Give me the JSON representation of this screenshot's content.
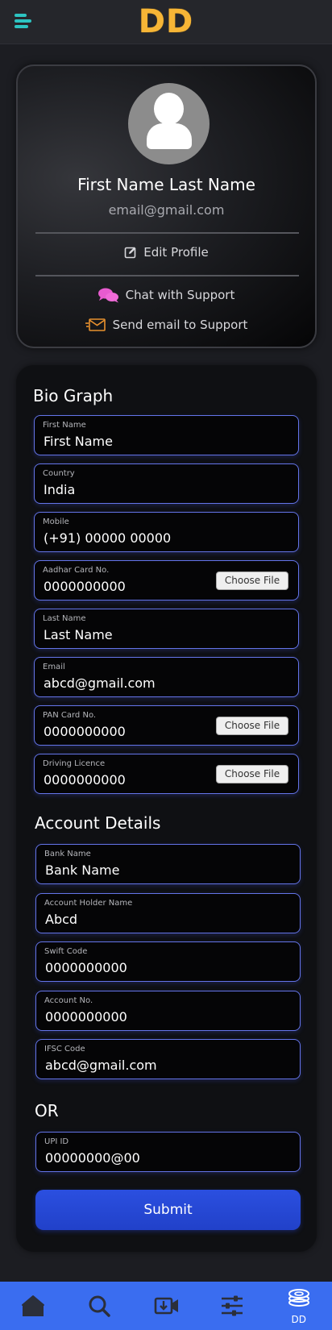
{
  "header": {
    "logo_text": "DD"
  },
  "profile": {
    "name": "First Name Last Name",
    "email": "email@gmail.com",
    "edit_label": "Edit Profile",
    "chat_label": "Chat with Support",
    "email_support_label": "Send email to Support"
  },
  "bio": {
    "title": "Bio Graph",
    "fields": [
      {
        "label": "First Name",
        "value": "First Name"
      },
      {
        "label": "Country",
        "value": "India"
      },
      {
        "label": "Mobile",
        "value": "(+91) 00000 00000"
      },
      {
        "label": "Aadhar Card No.",
        "value": "0000000000",
        "button": "Choose File"
      },
      {
        "label": "Last Name",
        "value": "Last Name"
      },
      {
        "label": "Email",
        "value": "abcd@gmail.com"
      },
      {
        "label": "PAN Card No.",
        "value": "0000000000",
        "button": "Choose File"
      },
      {
        "label": "Driving Licence",
        "value": "0000000000",
        "button": "Choose File"
      }
    ]
  },
  "account": {
    "title": "Account Details",
    "fields": [
      {
        "label": "Bank Name",
        "value": "Bank Name"
      },
      {
        "label": "Account Holder Name",
        "value": "Abcd"
      },
      {
        "label": "Swift Code",
        "value": "0000000000"
      },
      {
        "label": "Account No.",
        "value": "0000000000"
      },
      {
        "label": "IFSC Code",
        "value": "abcd@gmail.com"
      }
    ]
  },
  "or_label": "OR",
  "upi": {
    "label": "UPI ID",
    "value": "00000000@00"
  },
  "submit_label": "Submit",
  "bottom_nav": {
    "items": [
      {
        "icon": "home-icon"
      },
      {
        "icon": "search-icon"
      },
      {
        "icon": "video-download-icon"
      },
      {
        "icon": "sliders-icon"
      },
      {
        "icon": "coins-icon",
        "label": "DD"
      }
    ]
  },
  "colors": {
    "accent": "#2dc3c1",
    "logo": "#f6b536",
    "field_border": "#6474e8",
    "nav_bg": "#3a6df0"
  }
}
